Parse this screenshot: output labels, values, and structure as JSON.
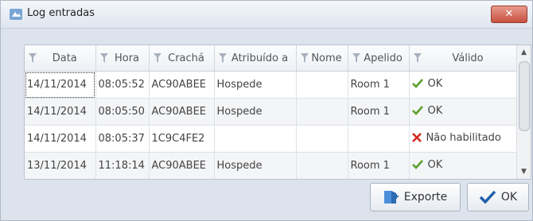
{
  "window": {
    "title": "Log entradas",
    "close_label": "✕"
  },
  "grid": {
    "columns": [
      "Data",
      "Hora",
      "Crachá",
      "Atribuído a",
      "Nome",
      "Apelido",
      "Válido"
    ],
    "rows": [
      {
        "data": "14/11/2014",
        "hora": "08:05:52",
        "cracha": "AC90ABEE",
        "atribuido": "Hospede",
        "nome": "",
        "apelido": "Room 1",
        "status": "ok",
        "valido": "OK"
      },
      {
        "data": "14/11/2014",
        "hora": "08:05:50",
        "cracha": "AC90ABEE",
        "atribuido": "Hospede",
        "nome": "",
        "apelido": "Room 1",
        "status": "ok",
        "valido": "OK"
      },
      {
        "data": "14/11/2014",
        "hora": "08:05:37",
        "cracha": "1C9C4FE2",
        "atribuido": "",
        "nome": "",
        "apelido": "",
        "status": "error",
        "valido": "Não habilitado"
      },
      {
        "data": "13/11/2014",
        "hora": "11:18:14",
        "cracha": "AC90ABEE",
        "atribuido": "Hospede",
        "nome": "",
        "apelido": "Room 1",
        "status": "ok",
        "valido": "OK"
      }
    ]
  },
  "buttons": {
    "export_label": "Exporte",
    "ok_label": "OK"
  },
  "colors": {
    "ok_check": "#5aa02c",
    "error_x": "#d6261c",
    "accent": "#1f5fa8"
  }
}
